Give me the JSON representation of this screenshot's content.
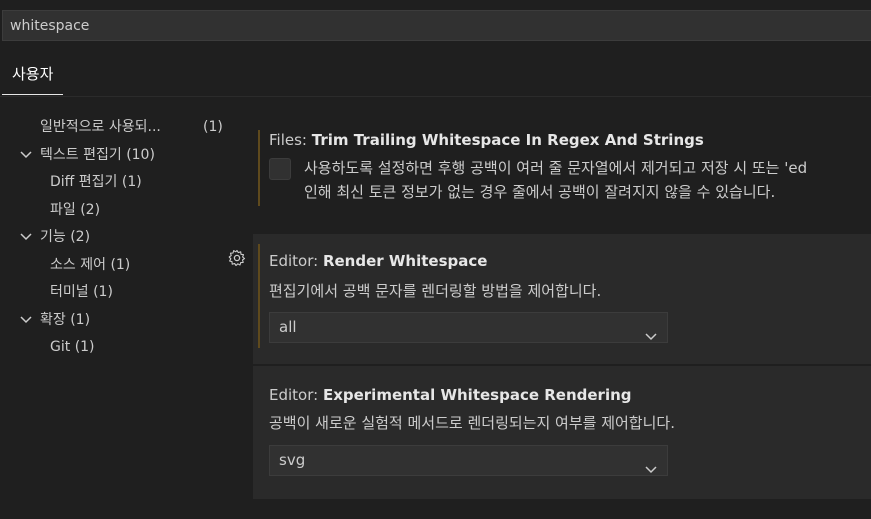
{
  "search": {
    "value": "whitespace"
  },
  "tabs": [
    {
      "label": "사용자"
    }
  ],
  "toc": {
    "items": [
      {
        "label": "일반적으로 사용되...",
        "count": "(1)"
      },
      {
        "label": "텍스트 편집기",
        "count": "(10)"
      },
      {
        "label": "Diff 편집기",
        "count": "(1)"
      },
      {
        "label": "파일",
        "count": "(2)"
      },
      {
        "label": "기능",
        "count": "(2)"
      },
      {
        "label": "소스 제어",
        "count": "(1)"
      },
      {
        "label": "터미널",
        "count": "(1)"
      },
      {
        "label": "확장",
        "count": "(1)"
      },
      {
        "label": "Git",
        "count": "(1)"
      }
    ]
  },
  "settings": [
    {
      "category": "Files: ",
      "name": "Trim Trailing Whitespace In Regex And Strings",
      "description_line1": "사용하도록 설정하면 후행 공백이 여러 줄 문자열에서 제거되고 저장 시 또는 'ed",
      "description_line2": "인해 최신 토큰 정보가 없는 경우 줄에서 공백이 잘려지지 않을 수 있습니다.",
      "checked": false
    },
    {
      "category": "Editor: ",
      "name": "Render Whitespace",
      "description": "편집기에서 공백 문자를 렌더링할 방법을 제어합니다.",
      "value": "all"
    },
    {
      "category": "Editor: ",
      "name": "Experimental Whitespace Rendering",
      "description": "공백이 새로운 실험적 메서드로 렌더링되는지 여부를 제어합니다.",
      "value": "svg"
    }
  ],
  "colors": {
    "modified_bar": "#5f4a1d",
    "focus_bg": "#2a2a2a",
    "tab_underline": "#e7e7e7"
  }
}
